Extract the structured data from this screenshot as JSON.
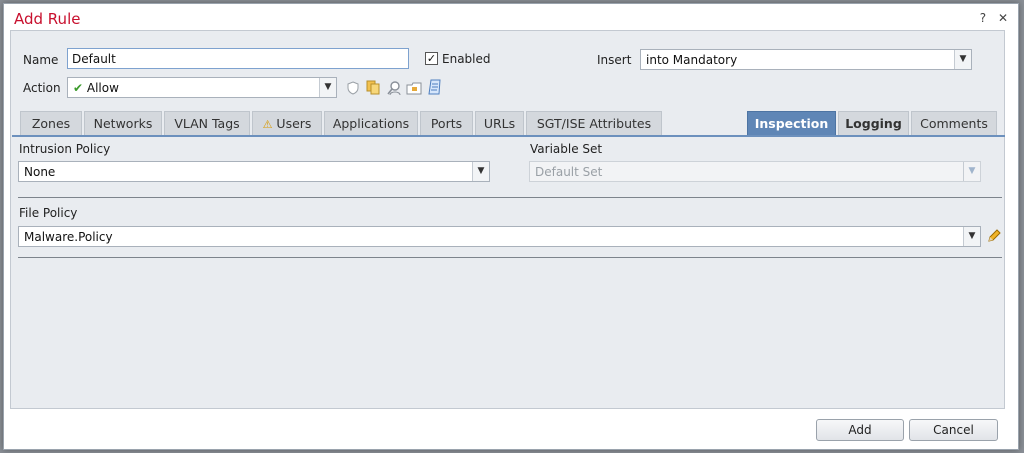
{
  "dialog": {
    "title": "Add Rule",
    "help": "?",
    "close": "✕"
  },
  "form": {
    "name_label": "Name",
    "name_value": "Default",
    "enabled_label": "Enabled",
    "enabled_checked": true,
    "insert_label": "Insert",
    "insert_value": "into Mandatory",
    "action_label": "Action",
    "action_value": "Allow"
  },
  "tabs": [
    {
      "label": "Zones"
    },
    {
      "label": "Networks"
    },
    {
      "label": "VLAN Tags"
    },
    {
      "label": "Users",
      "warning": true
    },
    {
      "label": "Applications"
    },
    {
      "label": "Ports"
    },
    {
      "label": "URLs"
    },
    {
      "label": "SGT/ISE Attributes"
    },
    {
      "label": "Inspection",
      "active": true
    },
    {
      "label": "Logging"
    },
    {
      "label": "Comments"
    }
  ],
  "inspection": {
    "intrusion_policy_label": "Intrusion Policy",
    "intrusion_policy_value": "None",
    "variable_set_label": "Variable Set",
    "variable_set_value": "Default Set",
    "file_policy_label": "File Policy",
    "file_policy_value": "Malware.Policy"
  },
  "footer": {
    "add_label": "Add",
    "cancel_label": "Cancel"
  },
  "colors": {
    "title": "#c8102e",
    "active_tab": "#5f86b6",
    "allow_check": "#3a9a2a"
  }
}
